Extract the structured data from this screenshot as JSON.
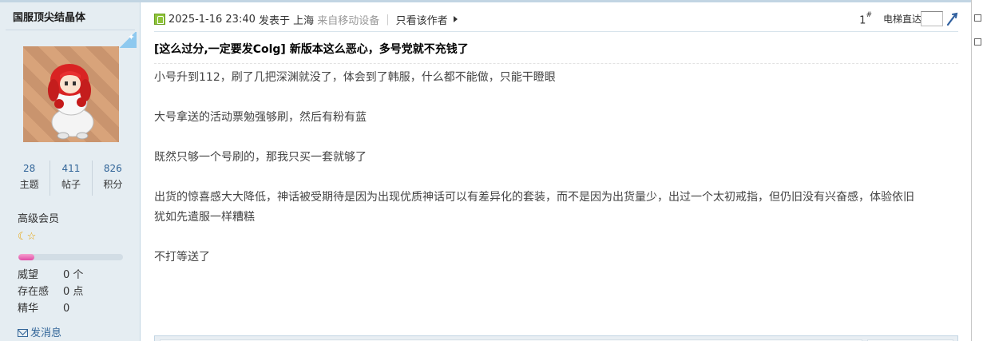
{
  "user": {
    "name": "国服顶尖结晶体",
    "stats": [
      {
        "value": "28",
        "label": "主题"
      },
      {
        "value": "411",
        "label": "帖子"
      },
      {
        "value": "826",
        "label": "积分"
      }
    ],
    "rank": "高级会员",
    "level_progress_percent": 15,
    "props": [
      {
        "key": "威望",
        "value": "0 个"
      },
      {
        "key": "存在感",
        "value": "0 点"
      },
      {
        "key": "精华",
        "value": "0"
      }
    ],
    "send_message": "发消息",
    "corner_tab_glyph": "✦",
    "icons": {
      "rank_moon": "☾",
      "rank_star": "☆"
    }
  },
  "post": {
    "date": "2025-1-16 23:40",
    "posted_at": "发表于",
    "location": "上海",
    "device": "来自移动设备",
    "author_only": "只看该作者",
    "floor": "1",
    "floor_suffix": "#",
    "jump_label": "电梯直达",
    "title": "[这么过分,一定要发Colg] 新版本这么恶心，多号党就不充钱了",
    "paragraphs": [
      "小号升到112，刷了几把深渊就没了，体会到了韩服，什么都不能做，只能干瞪眼",
      "",
      "大号拿送的活动票勉强够刷，然后有粉有蓝",
      "",
      "既然只够一个号刷的，那我只买一套就够了",
      "",
      "出货的惊喜感大大降低，神话被受期待是因为出现优质神话可以有差异化的套装，而不是因为出货量少，出过一个太初戒指，但仍旧没有兴奋感，体验依旧",
      "犹如先遣服一样糟糕",
      "",
      "不打等送了"
    ]
  },
  "colors": {
    "sidebar_bg": "#e5edf2",
    "link": "#336699",
    "progress": "#e04ca6",
    "online": "#8fc43a"
  }
}
